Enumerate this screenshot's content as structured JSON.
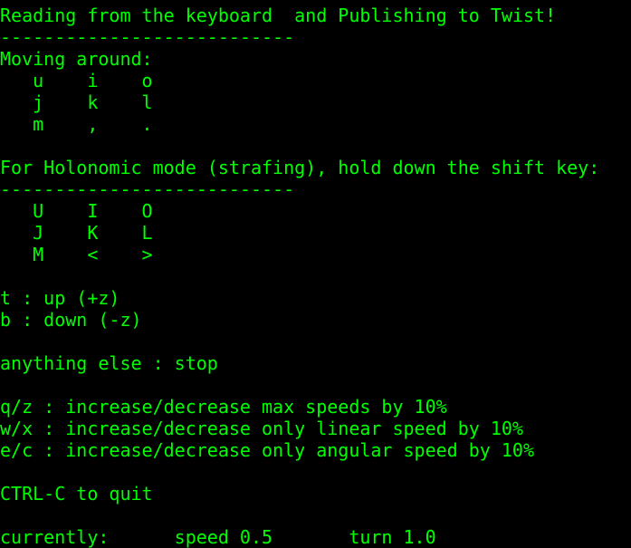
{
  "terminal": {
    "text_color": "#00ff00",
    "background": "#000000",
    "lines": [
      "Reading from the keyboard  and Publishing to Twist!",
      "---------------------------",
      "Moving around:",
      "   u    i    o",
      "   j    k    l",
      "   m    ,    .",
      "",
      "For Holonomic mode (strafing), hold down the shift key:",
      "---------------------------",
      "   U    I    O",
      "   J    K    L",
      "   M    <    >",
      "",
      "t : up (+z)",
      "b : down (-z)",
      "",
      "anything else : stop",
      "",
      "q/z : increase/decrease max speeds by 10%",
      "w/x : increase/decrease only linear speed by 10%",
      "e/c : increase/decrease only angular speed by 10%",
      "",
      "CTRL-C to quit",
      "",
      "currently:      speed 0.5       turn 1.0"
    ]
  }
}
